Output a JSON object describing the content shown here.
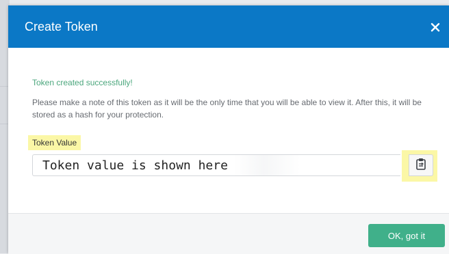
{
  "modal": {
    "title": "Create Token",
    "close_icon": "close-icon"
  },
  "body": {
    "success_message": "Token created successfully!",
    "note": "Please make a note of this token as it will be the only time that you will be able to view it. After this, it will be stored as a hash for your protection.",
    "token_label": "Token Value",
    "token_value": "Token value is shown here",
    "copy_icon": "clipboard-icon"
  },
  "footer": {
    "ok_label": "OK, got it"
  },
  "colors": {
    "header": "#0b78c6",
    "success": "#4aa67c",
    "highlight": "#fbf7a6",
    "ok_button": "#40b08a"
  }
}
